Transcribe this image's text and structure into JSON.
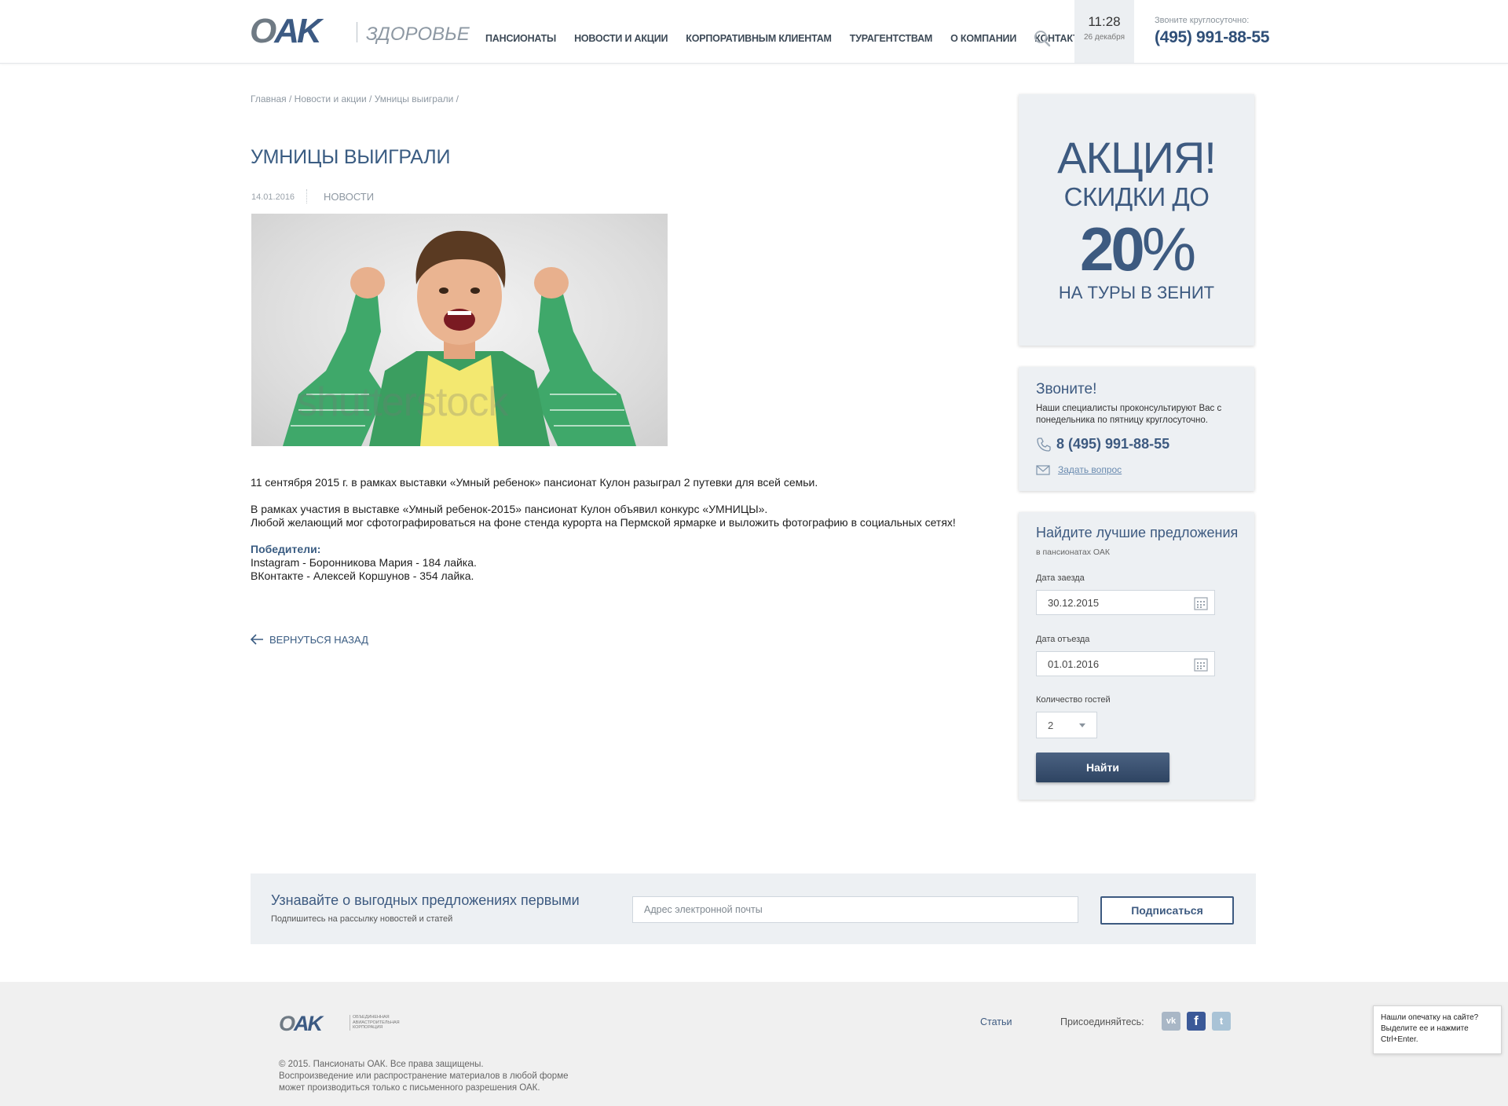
{
  "header": {
    "logo": {
      "brand": "OAK",
      "subtitle": "ЗДОРОВЬЕ"
    },
    "nav": [
      "ПАНСИОНАТЫ",
      "НОВОСТИ И АКЦИИ",
      "КОРПОРАТИВНЫМ КЛИЕНТАМ",
      "ТУРАГЕНТСТВАМ",
      "О КОМПАНИИ",
      "КОНТАКТЫ"
    ],
    "search_icon": "search-icon",
    "time": "11:28",
    "date": "26 декабря",
    "phone_caption": "Звоните круглосуточно:",
    "phone": "(495) 991-88-55"
  },
  "breadcrumb": "Главная / Новости и акции / Умницы выиграли /",
  "article": {
    "title": "УМНИЦЫ ВЫИГРАЛИ",
    "date": "14.01.2016",
    "category": "НОВОСТИ",
    "image_watermark": "shutterstock",
    "paragraph1": "11 сентября 2015 г. в рамках выставки «Умный ребенок» пансионат Кулон разыграл 2 путевки для всей семьи.",
    "paragraph2_line1": "В рамках участия в выставке «Умный ребенок-2015» пансионат Кулон объявил конкурс «УМНИЦЫ».",
    "paragraph2_line2": "Любой желающий мог сфотографироваться на фоне стенда курорта на Пермской ярмарке и выложить фотографию в социальных сетях!",
    "winners_label": "Победители",
    "winners_colon": ":",
    "winner1": "Instagram - Боронникова Мария - 184 лайка.",
    "winner2": "ВКонтакте - Алексей Коршунов - 354 лайка.",
    "back_label": "ВЕРНУТЬСЯ НАЗАД"
  },
  "promo": {
    "line1": "АКЦИЯ!",
    "line2": "СКИДКИ ДО",
    "line3_number": "20",
    "line3_pct": "%",
    "line4": "НА ТУРЫ В ЗЕНИТ"
  },
  "contact": {
    "title": "Звоните!",
    "text": "Наши специалисты проконсультируют Вас с понедельника по пятницу круглосуточно.",
    "phone": "8 (495) 991-88-55",
    "ask": "Задать вопрос"
  },
  "booking": {
    "title": "Найдите лучшие предложения",
    "subtitle": "в пансионатах ОАК",
    "checkin_label": "Дата заезда",
    "checkin_value": "30.12.2015",
    "checkout_label": "Дата отъезда",
    "checkout_value": "01.01.2016",
    "guests_label": "Количество гостей",
    "guests_value": "2",
    "find_label": "Найти"
  },
  "subscribe": {
    "title": "Узнавайте о выгодных предложениях первыми",
    "text": "Подпишитесь на рассылку новостей и статей",
    "email_placeholder": "Адрес электронной почты",
    "button": "Подписаться"
  },
  "footer": {
    "logo_brand": "OAK",
    "logo_sub": "ОБЪЕДИНЕННАЯ АВИАСТРОИТЕЛЬНАЯ КОРПОРАЦИЯ",
    "copy_line1": "© 2015. Пансионаты ОАК. Все права защищены.",
    "copy_line2": "Воспроизведение или распространение материалов в любой форме",
    "copy_line3": "может производиться только с письменного разрешения ОАК.",
    "articles": "Статьи",
    "join": "Присоединяйтесь:",
    "social": [
      "vk-icon",
      "facebook-icon",
      "twitter-icon"
    ]
  },
  "typo_hint": {
    "line1": "Нашли опечатку на сайте?",
    "line2": "Выделите ее и нажмите",
    "line3": "Ctrl+Enter."
  }
}
